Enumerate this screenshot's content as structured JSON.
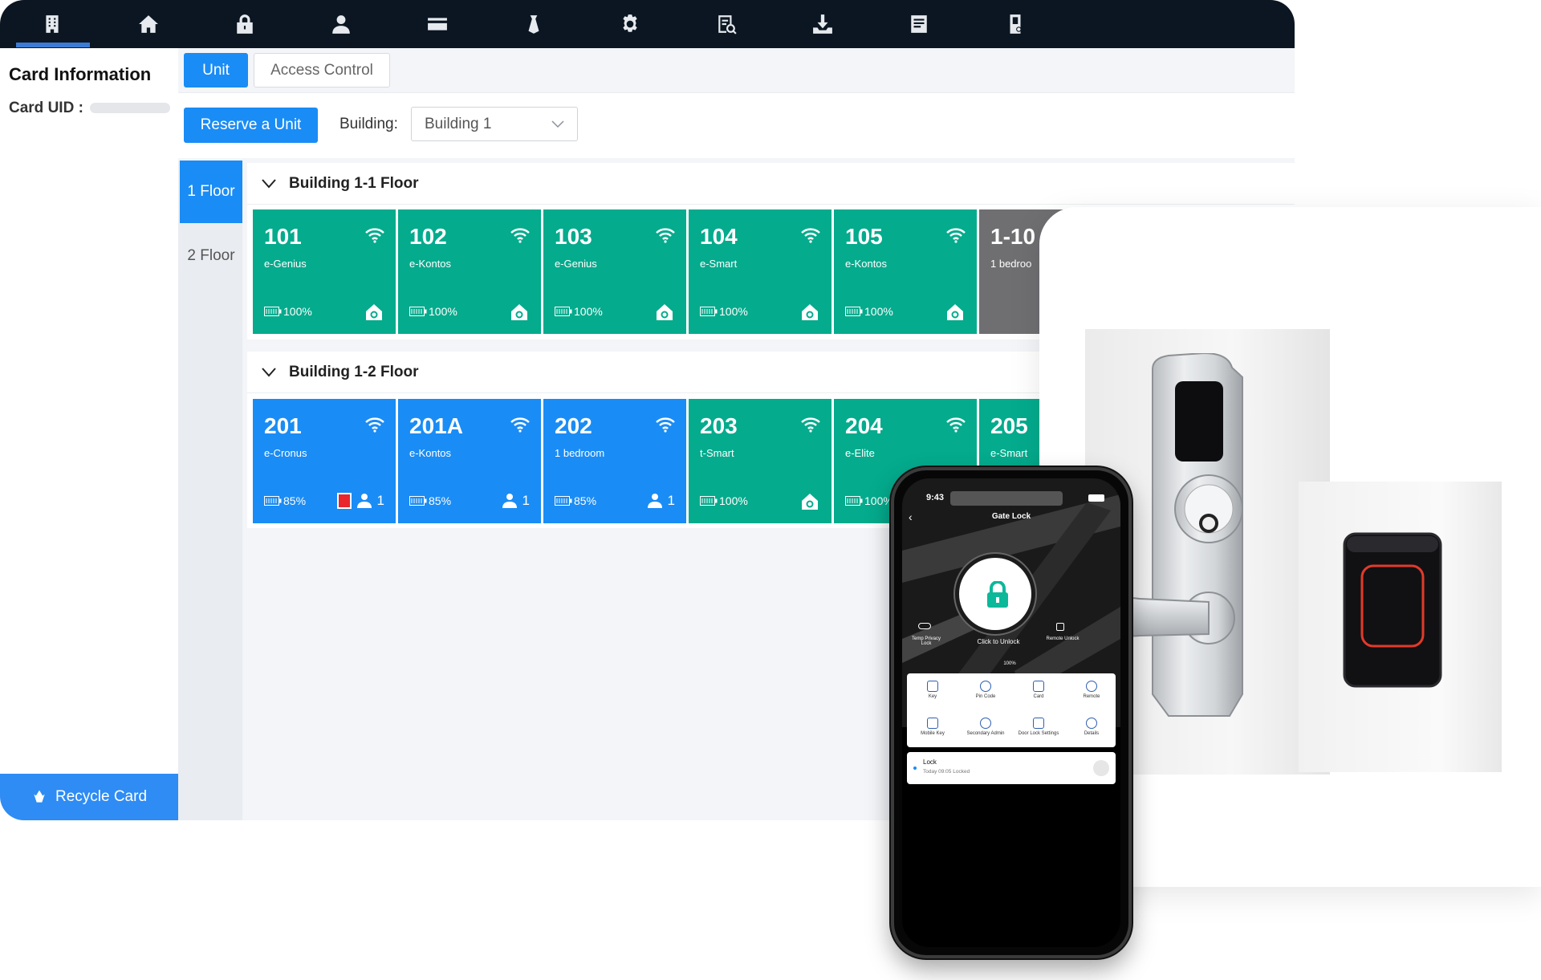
{
  "nav": {
    "items": [
      {
        "name": "building-icon",
        "active": true
      },
      {
        "name": "home-icon"
      },
      {
        "name": "lock-icon"
      },
      {
        "name": "user-icon"
      },
      {
        "name": "card-icon"
      },
      {
        "name": "tie-icon"
      },
      {
        "name": "gear-icon"
      },
      {
        "name": "report-search-icon"
      },
      {
        "name": "download-icon"
      },
      {
        "name": "log-icon"
      },
      {
        "name": "device-icon"
      }
    ],
    "background": "#0b1622"
  },
  "card_panel": {
    "title": "Card Information",
    "uid_label": "Card UID :",
    "recycle_label": "Recycle Card"
  },
  "tabs": {
    "unit": "Unit",
    "access_control": "Access Control"
  },
  "toolbar": {
    "reserve_label": "Reserve a Unit",
    "building_label": "Building:",
    "building_value": "Building 1"
  },
  "floors": {
    "floor1": "1 Floor",
    "floor2": "2 Floor"
  },
  "sections": [
    {
      "title": "Building 1-1 Floor",
      "units": [
        {
          "num": "101",
          "type": "e-Genius",
          "battery": "100%",
          "status": "vacant",
          "color": "#04ab8d"
        },
        {
          "num": "102",
          "type": "e-Kontos",
          "battery": "100%",
          "status": "vacant",
          "color": "#04ab8d"
        },
        {
          "num": "103",
          "type": "e-Genius",
          "battery": "100%",
          "status": "vacant",
          "color": "#04ab8d"
        },
        {
          "num": "104",
          "type": "e-Smart",
          "battery": "100%",
          "status": "vacant",
          "color": "#04ab8d"
        },
        {
          "num": "105",
          "type": "e-Kontos",
          "battery": "100%",
          "status": "vacant",
          "color": "#04ab8d"
        },
        {
          "num": "1-10",
          "type": "1 bedroo",
          "battery": "",
          "status": "unavailable",
          "color": "#6f6f72"
        }
      ]
    },
    {
      "title": "Building 1-2 Floor",
      "units": [
        {
          "num": "201",
          "type": "e-Cronus",
          "battery": "85%",
          "status": "occupied",
          "occupants": "1",
          "door_alert": true,
          "color": "#1a8cf5"
        },
        {
          "num": "201A",
          "type": "e-Kontos",
          "battery": "85%",
          "status": "occupied",
          "occupants": "1",
          "color": "#1a8cf5"
        },
        {
          "num": "202",
          "type": "1 bedroom",
          "battery": "85%",
          "status": "occupied",
          "occupants": "1",
          "color": "#1a8cf5"
        },
        {
          "num": "203",
          "type": "t-Smart",
          "battery": "100%",
          "status": "vacant",
          "color": "#04ab8d"
        },
        {
          "num": "204",
          "type": "e-Elite",
          "battery": "100%",
          "status": "vacant",
          "color": "#04ab8d"
        },
        {
          "num": "205",
          "type": "e-Smart",
          "battery": "",
          "status": "vacant",
          "color": "#04ab8d"
        }
      ]
    }
  ],
  "phone": {
    "time": "9:43",
    "title": "Gate Lock",
    "center_label": "Click to Unlock",
    "left_label": "Temp Privacy Lock",
    "right_label": "Remote Unlock",
    "battery": "100%",
    "menu": [
      "Key",
      "Pin Code",
      "Card",
      "Remote",
      "Mobile Key",
      "Secondary Admin",
      "Door Lock Settings",
      "Details"
    ],
    "log_title": "Lock",
    "log_detail": "Today 09:05 Locked",
    "accent": "#0bb89a"
  }
}
